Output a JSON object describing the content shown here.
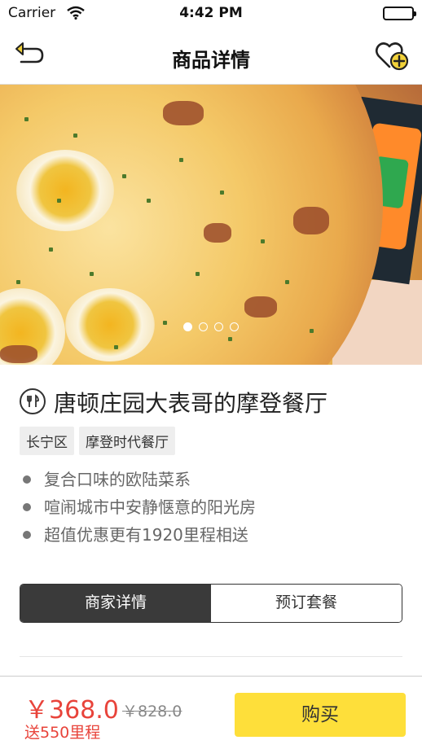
{
  "status_bar": {
    "carrier": "Carrier",
    "time": "4:42 PM"
  },
  "nav": {
    "title": "商品详情",
    "back_icon": "back-arrow-icon",
    "fav_icon": "heart-add-icon"
  },
  "gallery": {
    "page_count": 4,
    "active_index": 0
  },
  "shop": {
    "name": "唐顿庄园大表哥的摩登餐厅",
    "icon": "restaurant-icon",
    "tags": [
      "长宁区",
      "摩登时代餐厅"
    ],
    "features": [
      "复合口味的欧陆菜系",
      "喧闹城市中安静惬意的阳光房",
      "超值优惠更有1920里程相送"
    ]
  },
  "tabs": [
    {
      "label": "商家详情",
      "active": true
    },
    {
      "label": "预订套餐",
      "active": false
    }
  ],
  "bottom": {
    "price": "￥368.0",
    "original_price": "￥828.0",
    "miles": "送550里程",
    "buy_label": "购买"
  },
  "colors": {
    "accent": "#fedf3a",
    "price": "#e8433a",
    "tab_active": "#3a3a3a"
  }
}
